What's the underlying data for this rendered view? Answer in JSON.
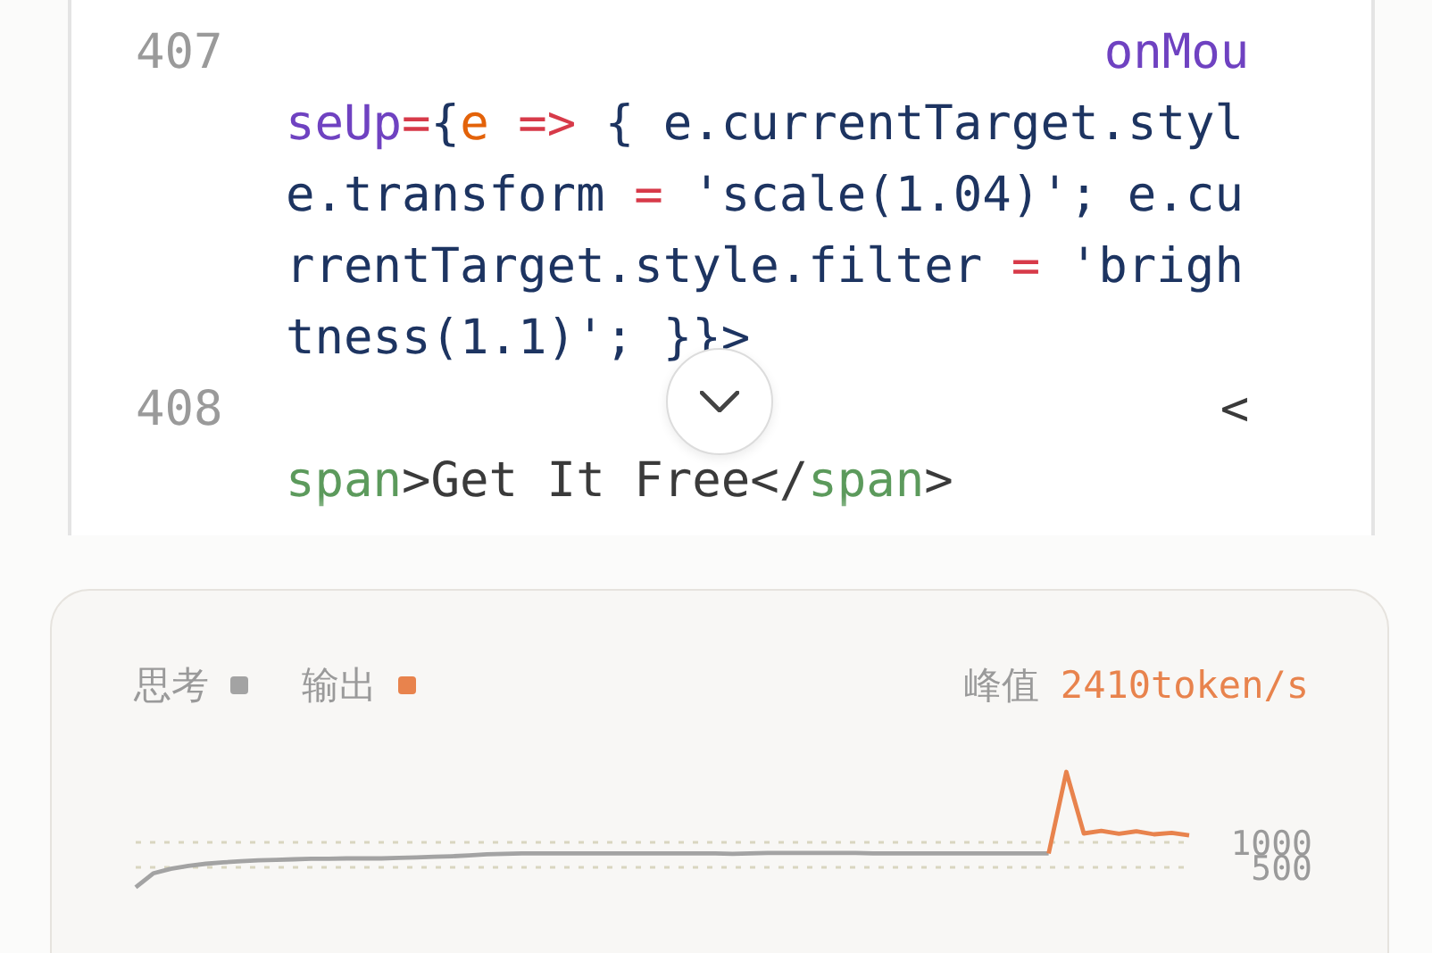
{
  "code": {
    "lines": [
      {
        "number": "407",
        "rows": [
          {
            "tokens": [
              {
                "t": "onMou",
                "kind": "attr"
              }
            ]
          },
          {
            "tokens": [
              {
                "t": "seUp",
                "kind": "attr"
              },
              {
                "t": "=",
                "kind": "op"
              },
              {
                "t": "{",
                "kind": "plain"
              },
              {
                "t": "e",
                "kind": "param"
              },
              {
                "t": " => ",
                "kind": "op"
              },
              {
                "t": "{ e.currentTarget.styl",
                "kind": "plain"
              }
            ]
          },
          {
            "tokens": [
              {
                "t": "e.transform ",
                "kind": "plain"
              },
              {
                "t": "=",
                "kind": "op"
              },
              {
                "t": " 'scale(1.04)'; e.cu",
                "kind": "plain"
              }
            ]
          },
          {
            "tokens": [
              {
                "t": "rrentTarget.style.filter ",
                "kind": "plain"
              },
              {
                "t": "=",
                "kind": "op"
              },
              {
                "t": " 'brigh",
                "kind": "plain"
              }
            ]
          },
          {
            "tokens": [
              {
                "t": "tness(1.1)'; }}>",
                "kind": "plain"
              }
            ]
          }
        ]
      },
      {
        "number": "408",
        "rows": [
          {
            "tokens": [
              {
                "t": "<",
                "kind": "text"
              }
            ]
          },
          {
            "tokens": [
              {
                "t": "span",
                "kind": "tag"
              },
              {
                "t": ">Get It Free</",
                "kind": "text"
              },
              {
                "t": "span",
                "kind": "tag"
              },
              {
                "t": ">",
                "kind": "text"
              }
            ]
          }
        ]
      }
    ]
  },
  "stats": {
    "legend": [
      {
        "label": "思考",
        "color": "#a3a3a3"
      },
      {
        "label": "输出",
        "color": "#e8834d"
      }
    ],
    "peak_label": "峰值",
    "peak_value": "2410token/s",
    "axis_labels": [
      "1000",
      "500"
    ]
  }
}
